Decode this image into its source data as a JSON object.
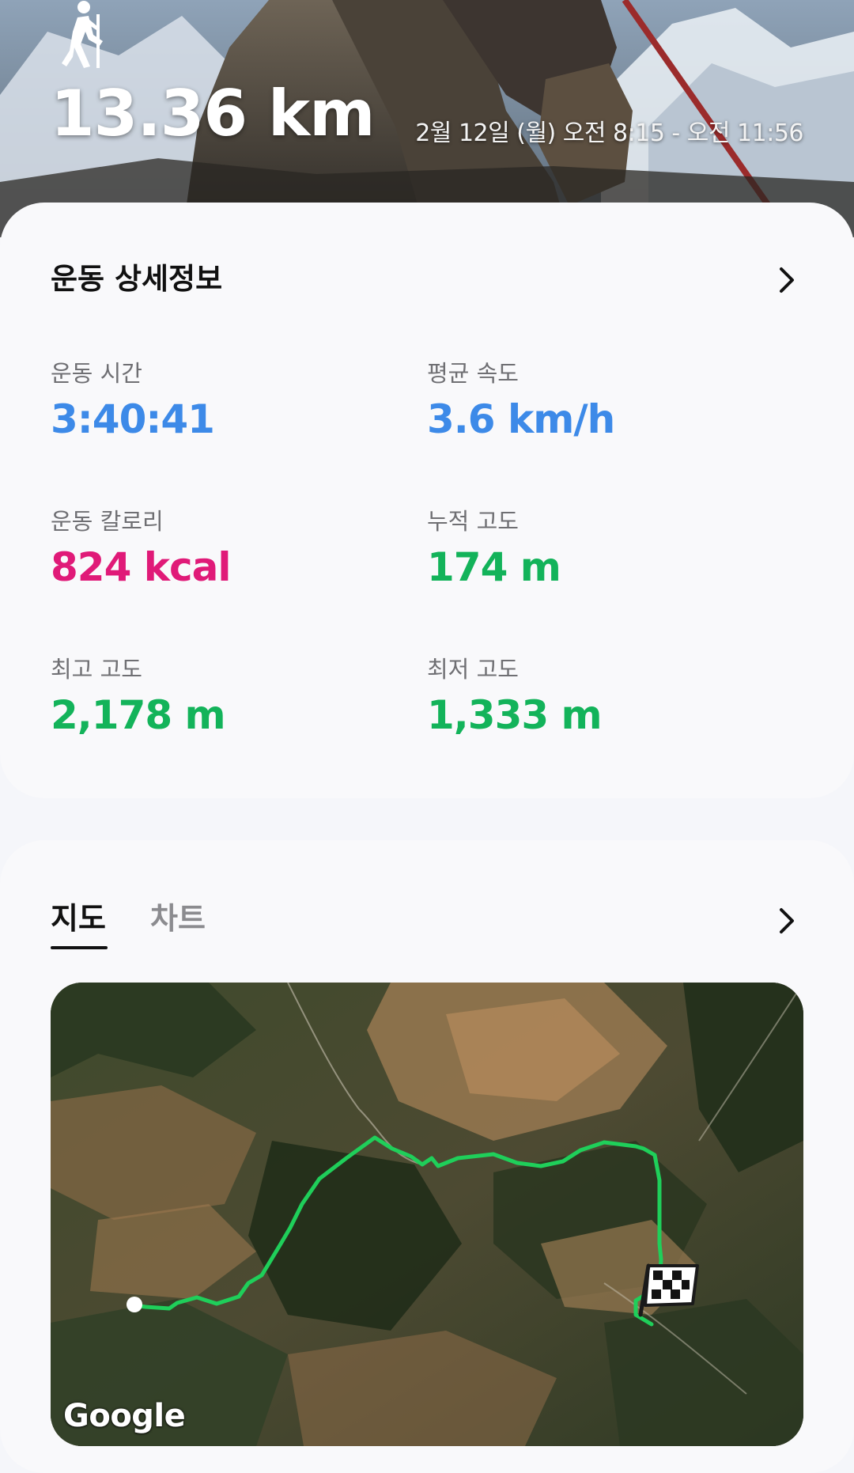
{
  "hero": {
    "distance": "13.36 km",
    "date_range": "2월 12일 (월) 오전 8:15 - 오전 11:56",
    "activity_icon": "hiking-icon"
  },
  "details": {
    "title": "운동 상세정보",
    "stats": [
      {
        "label": "운동 시간",
        "value": "3:40:41",
        "color": "#3d8ae8"
      },
      {
        "label": "평균 속도",
        "value": "3.6 km/h",
        "color": "#3d8ae8"
      },
      {
        "label": "운동 칼로리",
        "value": "824 kcal",
        "color": "#e01a78"
      },
      {
        "label": "누적 고도",
        "value": "174 m",
        "color": "#13b35a"
      },
      {
        "label": "최고 고도",
        "value": "2,178 m",
        "color": "#13b35a"
      },
      {
        "label": "최저 고도",
        "value": "1,333 m",
        "color": "#13b35a"
      }
    ]
  },
  "map_section": {
    "tabs": [
      {
        "label": "지도",
        "selected": true
      },
      {
        "label": "차트",
        "selected": false
      }
    ],
    "map_attribution": "Google",
    "route_color": "#1fcf5a",
    "start_marker": "white-dot",
    "finish_icon": "checkered-flag-icon"
  }
}
